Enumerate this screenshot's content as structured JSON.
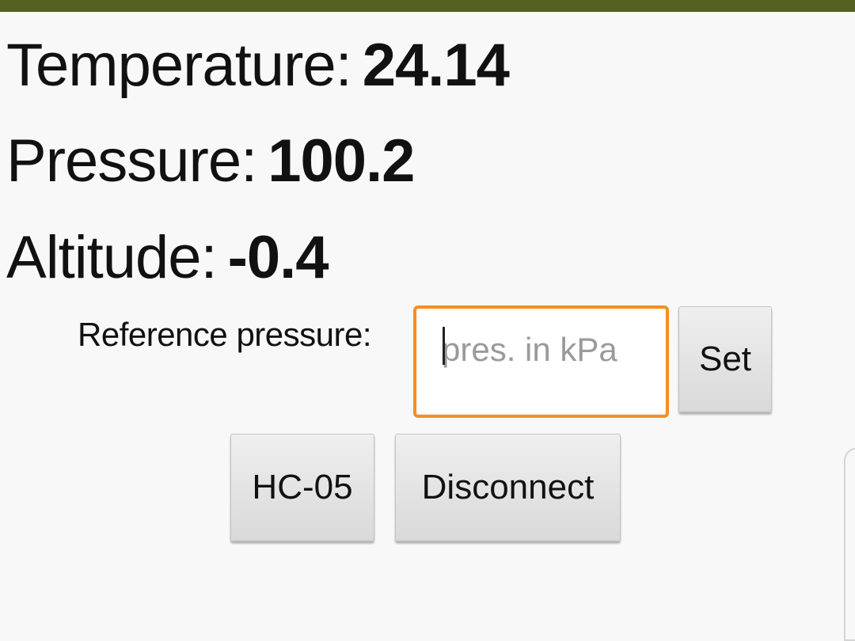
{
  "readings": {
    "temperature_label": "Temperature:",
    "temperature_value": "24.14",
    "pressure_label": "Pressure:",
    "pressure_value": "100.2",
    "altitude_label": "Altitude:",
    "altitude_value": "-0.4"
  },
  "reference": {
    "label": "Reference pressure:",
    "value": "",
    "placeholder": "pres. in kPa",
    "set_label": "Set"
  },
  "bluetooth": {
    "device_label": "HC-05",
    "disconnect_label": "Disconnect"
  },
  "colors": {
    "status_bar": "#536123",
    "input_focus_border": "#f39022",
    "background": "#f8f8f8"
  }
}
